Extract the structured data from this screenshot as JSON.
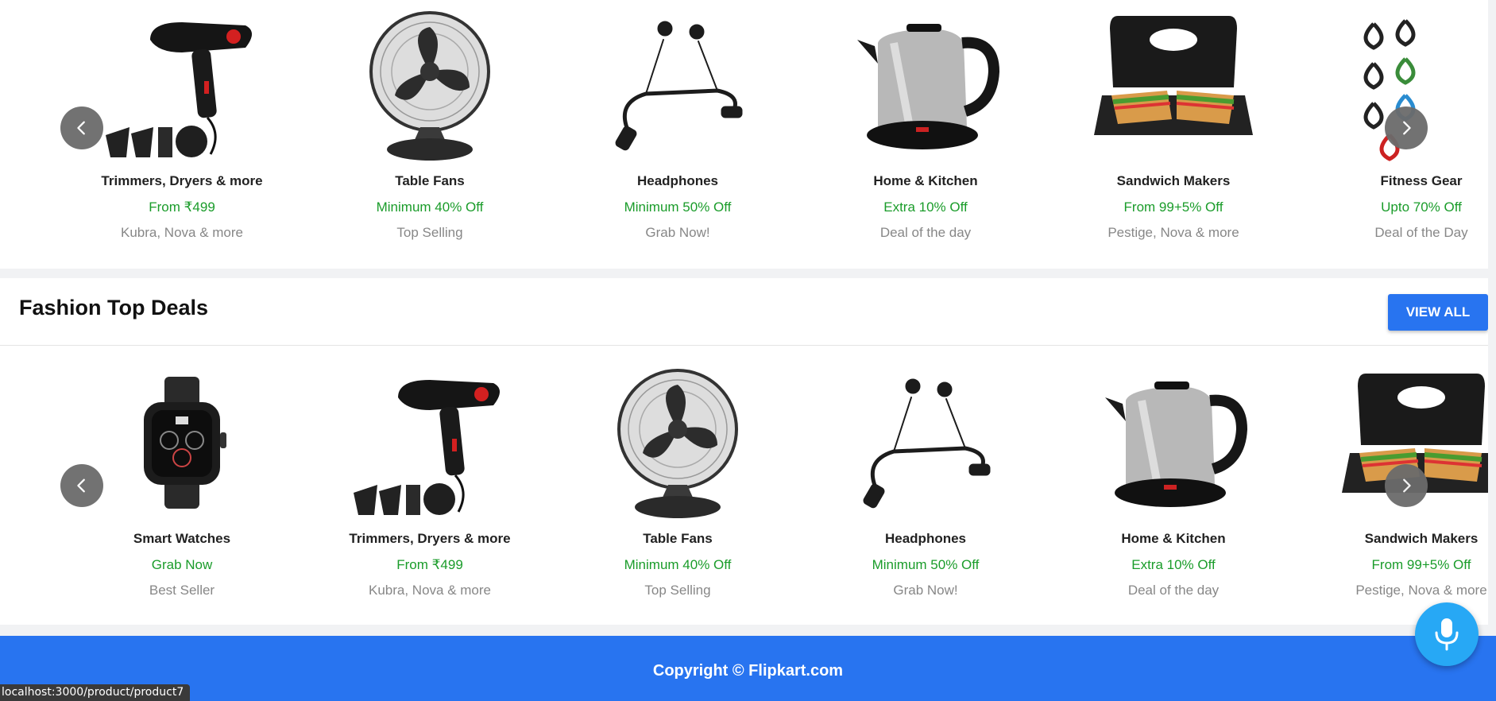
{
  "deals_row": {
    "items": [
      {
        "name": "Smart Watches",
        "offer": "Grab Now",
        "sub": "Best Seller",
        "icon": "smartwatch"
      },
      {
        "name": "Trimmers, Dryers & more",
        "offer": "From ₹499",
        "sub": "Kubra, Nova & more",
        "icon": "hair-dryer"
      },
      {
        "name": "Table Fans",
        "offer": "Minimum 40% Off",
        "sub": "Top Selling",
        "icon": "table-fan"
      },
      {
        "name": "Headphones",
        "offer": "Minimum 50% Off",
        "sub": "Grab Now!",
        "icon": "neckband-headphones"
      },
      {
        "name": "Home & Kitchen",
        "offer": "Extra 10% Off",
        "sub": "Deal of the day",
        "icon": "electric-kettle"
      },
      {
        "name": "Sandwich Makers",
        "offer": "From 99+5% Off",
        "sub": "Pestige, Nova & more",
        "icon": "sandwich-maker"
      },
      {
        "name": "Fitness Gear",
        "offer": "Upto 70% Off",
        "sub": "Deal of the Day",
        "icon": "resistance-bands"
      }
    ]
  },
  "fashion": {
    "title": "Fashion Top Deals",
    "view_all": "VIEW ALL",
    "items": [
      {
        "name": "Fitness Gear",
        "offer": "Upto 70% Off",
        "sub": "Deal of the Day",
        "icon": "fitness-man"
      },
      {
        "name": "Smart Watches",
        "offer": "Grab Now",
        "sub": "Best Seller",
        "icon": "smartwatch"
      },
      {
        "name": "Trimmers, Dryers & more",
        "offer": "From ₹499",
        "sub": "Kubra, Nova & more",
        "icon": "hair-dryer"
      },
      {
        "name": "Table Fans",
        "offer": "Minimum 40% Off",
        "sub": "Top Selling",
        "icon": "table-fan"
      },
      {
        "name": "Headphones",
        "offer": "Minimum 50% Off",
        "sub": "Grab Now!",
        "icon": "neckband-headphones"
      },
      {
        "name": "Home & Kitchen",
        "offer": "Extra 10% Off",
        "sub": "Deal of the day",
        "icon": "electric-kettle"
      },
      {
        "name": "Sandwich Makers",
        "offer": "From 99+5% Off",
        "sub": "Pestige, Nova & more",
        "icon": "sandwich-maker"
      }
    ]
  },
  "footer": {
    "copyright": "Copyright © Flipkart.com"
  },
  "status_bar": {
    "url": "localhost:3000/product/product7"
  },
  "colors": {
    "brand_blue": "#2874f0",
    "offer_green": "#1a9c2a",
    "mic_blue": "#27a8f5"
  },
  "icons": {
    "prev": "chevron-left-icon",
    "next": "chevron-right-icon",
    "mic": "microphone-icon"
  }
}
